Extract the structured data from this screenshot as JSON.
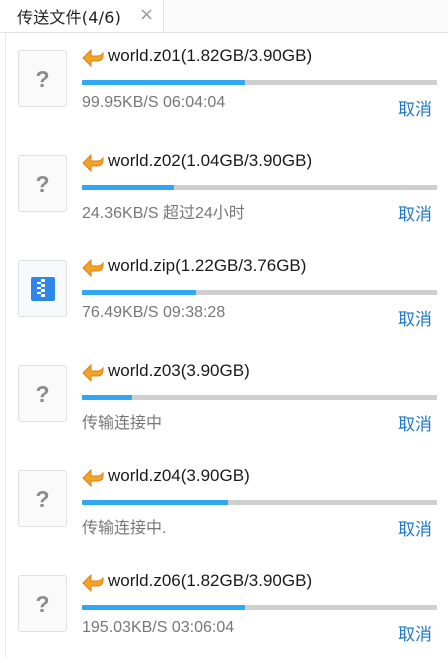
{
  "tab": {
    "title": "传送文件(4/6)",
    "close_symbol": "×"
  },
  "accent_color": "#2fa7f2",
  "link_color": "#1f78c8",
  "transfers": [
    {
      "file_name": "world.z01(1.82GB/3.90GB)",
      "progress": 0.46,
      "status": "99.95KB/S   06:04:04",
      "cancel_label": "取消",
      "thumb_icon": "unknown-file-icon",
      "direction_icon": "arrow-left-icon"
    },
    {
      "file_name": "world.z02(1.04GB/3.90GB)",
      "progress": 0.26,
      "status": "24.36KB/S   超过24小时",
      "cancel_label": "取消",
      "thumb_icon": "unknown-file-icon",
      "direction_icon": "arrow-left-icon"
    },
    {
      "file_name": "world.zip(1.22GB/3.76GB)",
      "progress": 0.32,
      "status": "76.49KB/S   09:38:28",
      "cancel_label": "取消",
      "thumb_icon": "zip-file-icon",
      "direction_icon": "arrow-left-icon"
    },
    {
      "file_name": "world.z03(3.90GB)",
      "progress": 0.14,
      "status": "传输连接中",
      "cancel_label": "取消",
      "thumb_icon": "unknown-file-icon",
      "direction_icon": "arrow-left-icon"
    },
    {
      "file_name": "world.z04(3.90GB)",
      "progress": 0.41,
      "status": "传输连接中.",
      "cancel_label": "取消",
      "thumb_icon": "unknown-file-icon",
      "direction_icon": "arrow-left-icon"
    },
    {
      "file_name": "world.z06(1.82GB/3.90GB)",
      "progress": 0.46,
      "status": "195.03KB/S   03:06:04",
      "cancel_label": "取消",
      "thumb_icon": "unknown-file-icon",
      "direction_icon": "arrow-left-icon"
    }
  ]
}
